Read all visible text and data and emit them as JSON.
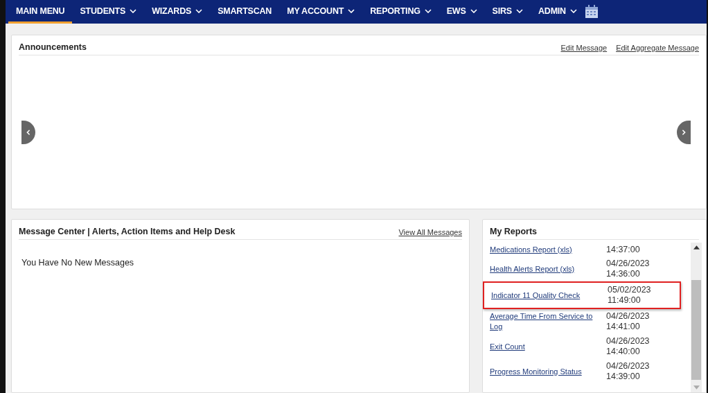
{
  "nav": [
    {
      "label": "MAIN MENU",
      "selected": true,
      "dropdown": false
    },
    {
      "label": "STUDENTS",
      "selected": false,
      "dropdown": true
    },
    {
      "label": "WIZARDS",
      "selected": false,
      "dropdown": true
    },
    {
      "label": "SMARTSCAN",
      "selected": false,
      "dropdown": false
    },
    {
      "label": "MY ACCOUNT",
      "selected": false,
      "dropdown": true
    },
    {
      "label": "REPORTING",
      "selected": false,
      "dropdown": true
    },
    {
      "label": "EWS",
      "selected": false,
      "dropdown": true
    },
    {
      "label": "SIRS",
      "selected": false,
      "dropdown": true
    },
    {
      "label": "ADMIN",
      "selected": false,
      "dropdown": true
    }
  ],
  "announcements": {
    "title": "Announcements",
    "links": [
      "Edit Message",
      "Edit Aggregate Message"
    ]
  },
  "message_center": {
    "title": "Message Center | Alerts, Action Items and Help Desk",
    "link": "View All Messages",
    "empty_text": "You Have No New Messages"
  },
  "my_reports": {
    "title": "My Reports",
    "rows": [
      {
        "name": "Medications Report (xls)",
        "date": "",
        "time": "14:37:00",
        "highlighted": false
      },
      {
        "name": "Health Alerts Report (xls)",
        "date": "04/26/2023",
        "time": "14:36:00",
        "highlighted": false
      },
      {
        "name": "Indicator 11 Quality Check",
        "date": "05/02/2023",
        "time": "11:49:00",
        "highlighted": true
      },
      {
        "name": "Average Time From Service to Log",
        "date": "04/26/2023",
        "time": "14:41:00",
        "highlighted": false
      },
      {
        "name": "Exit Count",
        "date": "04/26/2023",
        "time": "14:40:00",
        "highlighted": false
      },
      {
        "name": "Progress Monitoring Status",
        "date": "04/26/2023",
        "time": "14:39:00",
        "highlighted": false
      }
    ]
  }
}
